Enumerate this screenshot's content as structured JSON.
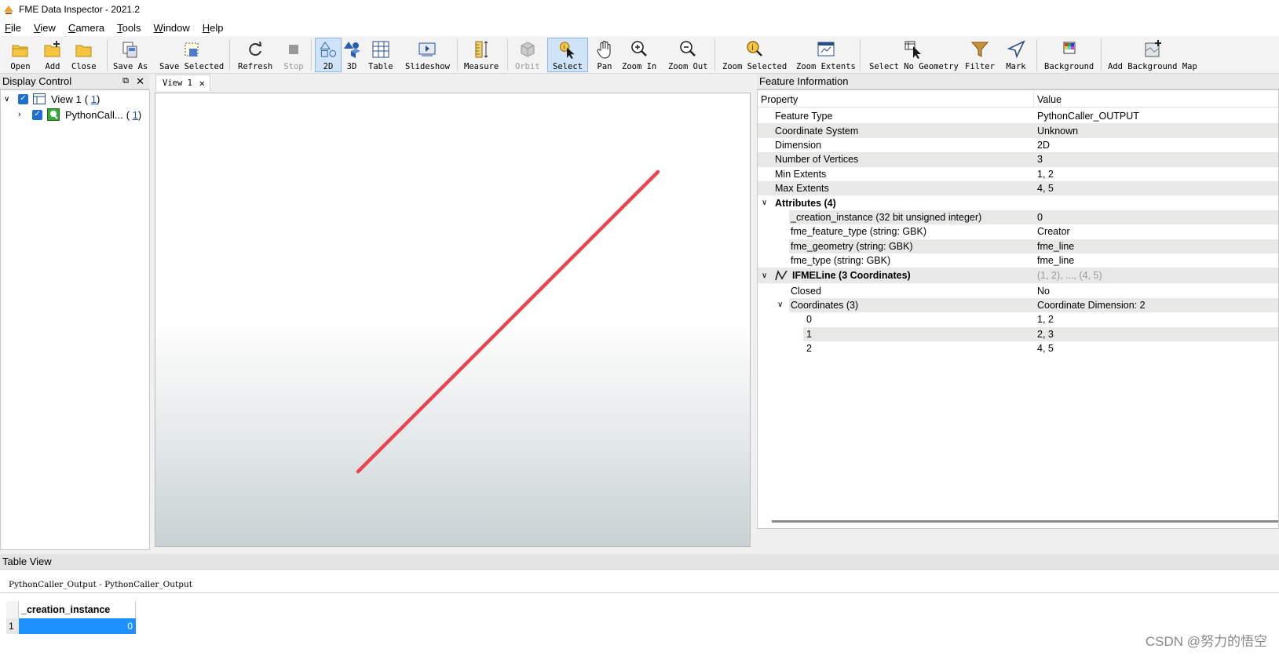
{
  "window": {
    "title": "FME Data Inspector - 2021.2"
  },
  "menu": [
    "File",
    "View",
    "Camera",
    "Tools",
    "Window",
    "Help"
  ],
  "toolbar": {
    "open": "Open",
    "add": "Add",
    "close": "Close",
    "save_as": "Save As",
    "save_selected": "Save Selected",
    "refresh": "Refresh",
    "stop": "Stop",
    "two_d": "2D",
    "three_d": "3D",
    "table": "Table",
    "slideshow": "Slideshow",
    "measure": "Measure",
    "orbit": "Orbit",
    "select": "Select",
    "pan": "Pan",
    "zoom_in": "Zoom In",
    "zoom_out": "Zoom Out",
    "zoom_selected": "Zoom Selected",
    "zoom_extents": "Zoom Extents",
    "select_no_geometry": "Select No Geometry",
    "filter": "Filter",
    "mark": "Mark",
    "background": "Background",
    "add_background_map": "Add Background Map"
  },
  "display_control": {
    "title": "Display Control",
    "items": [
      {
        "label": "View 1",
        "open": "( ",
        "count": "1",
        "close": ")"
      },
      {
        "label": "PythonCall...",
        "open": "( ",
        "count": "1",
        "close": ")"
      }
    ]
  },
  "view_tab": {
    "label": "View 1"
  },
  "viewport": {
    "line_color": "#e8454e",
    "line_coords": [
      [
        1,
        2
      ],
      [
        2,
        3
      ],
      [
        4,
        5
      ]
    ]
  },
  "feature_info": {
    "title": "Feature Information",
    "header_property": "Property",
    "header_value": "Value",
    "rows": [
      {
        "p": "Feature Type",
        "v": "PythonCaller_OUTPUT"
      },
      {
        "p": "Coordinate System",
        "v": "Unknown"
      },
      {
        "p": "Dimension",
        "v": "2D"
      },
      {
        "p": "Number of Vertices",
        "v": "3"
      },
      {
        "p": "Min Extents",
        "v": "1, 2"
      },
      {
        "p": "Max Extents",
        "v": "4, 5"
      },
      {
        "p": "Attributes (4)",
        "v": ""
      },
      {
        "p": "_creation_instance (32 bit unsigned integer)",
        "v": "0"
      },
      {
        "p": "fme_feature_type (string: GBK)",
        "v": "Creator"
      },
      {
        "p": "fme_geometry (string: GBK)",
        "v": "fme_line"
      },
      {
        "p": "fme_type (string: GBK)",
        "v": "fme_line"
      },
      {
        "p": "IFMELine (3 Coordinates)",
        "v": "(1, 2), ..., (4, 5)"
      },
      {
        "p": "Closed",
        "v": "No"
      },
      {
        "p": "Coordinates (3)",
        "v": "Coordinate Dimension: 2"
      },
      {
        "p": "0",
        "v": "1, 2"
      },
      {
        "p": "1",
        "v": "2, 3"
      },
      {
        "p": "2",
        "v": "4, 5"
      }
    ]
  },
  "table_view": {
    "title": "Table View",
    "source": "PythonCaller_Output - PythonCaller_Output",
    "column": "_creation_instance",
    "row_number": "1",
    "cell_value": "0"
  },
  "watermark": "CSDN @努力的悟空"
}
